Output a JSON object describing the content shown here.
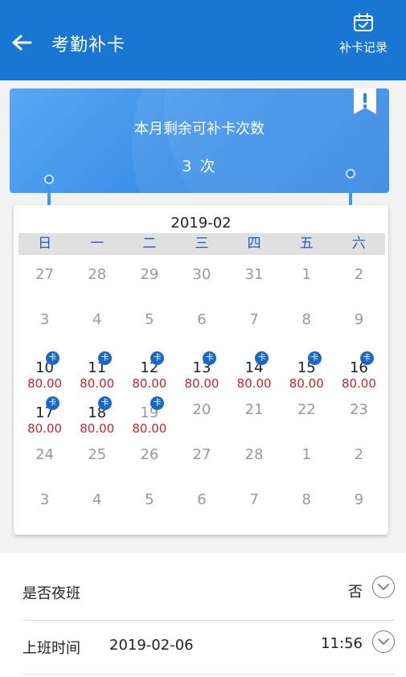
{
  "header": {
    "title": "考勤补卡",
    "back_icon": "arrow-left-icon",
    "record_label": "补卡记录",
    "record_icon": "calendar-check-icon",
    "color": "#1976d2"
  },
  "banner": {
    "label": "本月剩余可补卡次数",
    "count": "3 次",
    "icon": "exclamation-bookmark-icon"
  },
  "calendar": {
    "month": "2019-02",
    "weekdays": [
      "日",
      "一",
      "二",
      "三",
      "四",
      "五",
      "六"
    ],
    "badge_label": "卡",
    "weeks": [
      [
        {
          "d": "27",
          "m": true
        },
        {
          "d": "28",
          "m": true
        },
        {
          "d": "29",
          "m": true
        },
        {
          "d": "30",
          "m": true
        },
        {
          "d": "31",
          "m": true
        },
        {
          "d": "1",
          "m": true
        },
        {
          "d": "2",
          "m": true
        }
      ],
      [
        {
          "d": "3",
          "m": true
        },
        {
          "d": "4",
          "m": true
        },
        {
          "d": "5",
          "m": true
        },
        {
          "d": "6",
          "m": true
        },
        {
          "d": "7",
          "m": true
        },
        {
          "d": "8",
          "m": true
        },
        {
          "d": "9",
          "m": true
        }
      ],
      [
        {
          "d": "10",
          "a": "80.00",
          "b": true
        },
        {
          "d": "11",
          "a": "80.00",
          "b": true
        },
        {
          "d": "12",
          "a": "80.00",
          "b": true
        },
        {
          "d": "13",
          "a": "80.00",
          "b": true
        },
        {
          "d": "14",
          "a": "80.00",
          "b": true
        },
        {
          "d": "15",
          "a": "80.00",
          "b": true
        },
        {
          "d": "16",
          "a": "80.00",
          "b": true
        }
      ],
      [
        {
          "d": "17",
          "a": "80.00",
          "b": true
        },
        {
          "d": "18",
          "a": "80.00",
          "b": true
        },
        {
          "d": "19",
          "a": "80.00",
          "b": true,
          "m": true
        },
        {
          "d": "20",
          "m": true
        },
        {
          "d": "21",
          "m": true
        },
        {
          "d": "22",
          "m": true
        },
        {
          "d": "23",
          "m": true
        }
      ],
      [
        {
          "d": "24",
          "m": true
        },
        {
          "d": "25",
          "m": true
        },
        {
          "d": "26",
          "m": true
        },
        {
          "d": "27",
          "m": true
        },
        {
          "d": "28",
          "m": true
        },
        {
          "d": "1",
          "m": true
        },
        {
          "d": "2",
          "m": true
        }
      ],
      [
        {
          "d": "3",
          "m": true
        },
        {
          "d": "4",
          "m": true
        },
        {
          "d": "5",
          "m": true
        },
        {
          "d": "6",
          "m": true
        },
        {
          "d": "7",
          "m": true
        },
        {
          "d": "8",
          "m": true
        },
        {
          "d": "9",
          "m": true
        }
      ]
    ]
  },
  "form": {
    "night_shift": {
      "label": "是否夜班",
      "value": "否",
      "icon": "chevron-down-circle-icon"
    },
    "work_time": {
      "label": "上班时间",
      "date": "2019-02-06",
      "time": "11:56",
      "icon": "chevron-down-circle-icon"
    }
  }
}
